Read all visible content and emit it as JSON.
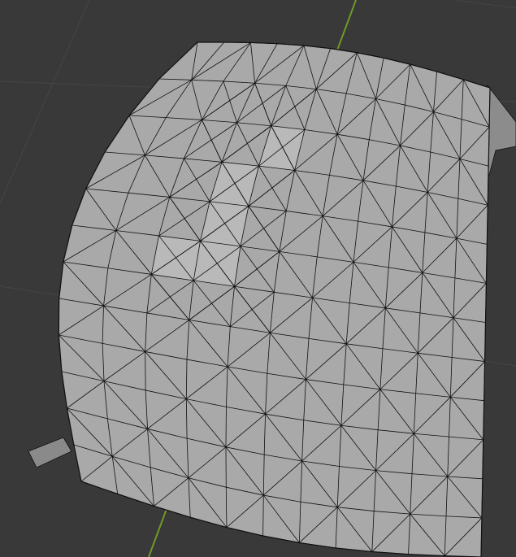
{
  "viewport": {
    "background_color": "#393939",
    "grid_color": "#454545",
    "y_axis_color": "#6e9a28",
    "mesh_fill_color": "#a9a9a9",
    "mesh_highlight_color": "#c4c4c4",
    "wire_color": "#111111",
    "grid_rows": 12,
    "grid_cols": 11
  }
}
